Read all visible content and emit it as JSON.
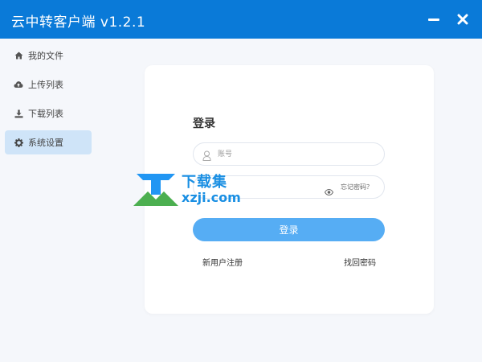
{
  "app": {
    "title": "云中转客户端 v1.2.1",
    "accent": "#0a7ad8"
  },
  "sidebar": {
    "items": [
      {
        "label": "我的文件",
        "icon": "home-icon",
        "active": false
      },
      {
        "label": "上传列表",
        "icon": "cloud-upload-icon",
        "active": false
      },
      {
        "label": "下载列表",
        "icon": "download-icon",
        "active": false
      },
      {
        "label": "系统设置",
        "icon": "gear-icon",
        "active": true
      }
    ],
    "active_color": "#cfe4f8"
  },
  "login": {
    "title": "登录",
    "account_placeholder": "账号",
    "forgot_hint": "忘记密码？",
    "submit_label": "登录",
    "submit_color": "#56adf4",
    "register_link": "新用户注册",
    "recover_link": "找回密码"
  },
  "watermark": {
    "cn": "下载集",
    "en": "xzji.com"
  }
}
